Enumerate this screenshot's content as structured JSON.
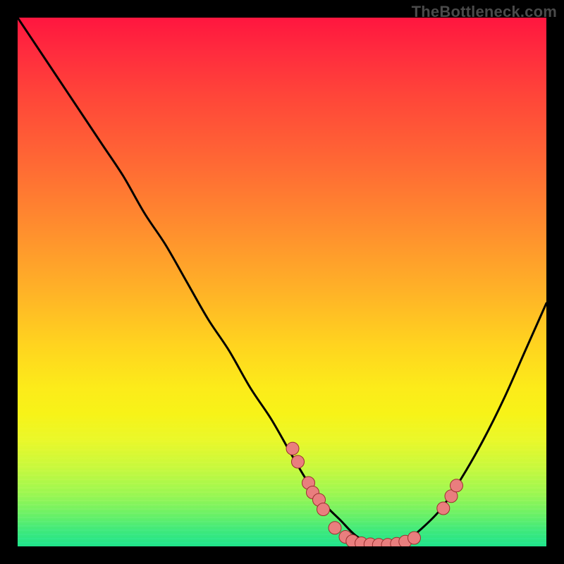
{
  "watermark": "TheBottleneck.com",
  "chart_data": {
    "type": "line",
    "title": "",
    "xlabel": "",
    "ylabel": "",
    "xlim": [
      0,
      100
    ],
    "ylim": [
      0,
      100
    ],
    "grid": false,
    "series": [
      {
        "name": "curve",
        "x": [
          0,
          4,
          8,
          12,
          16,
          20,
          24,
          28,
          32,
          36,
          40,
          44,
          48,
          52,
          55,
          58,
          61,
          64,
          67,
          70,
          73,
          76,
          80,
          84,
          88,
          92,
          96,
          100
        ],
        "y": [
          100,
          94,
          88,
          82,
          76,
          70,
          63,
          57,
          50,
          43,
          37,
          30,
          24,
          17,
          12,
          8,
          5,
          2,
          0.5,
          0,
          0.7,
          3,
          7,
          13,
          20,
          28,
          37,
          46
        ]
      }
    ],
    "markers": [
      {
        "x": 52.0,
        "y": 18.5
      },
      {
        "x": 53.0,
        "y": 16.0
      },
      {
        "x": 55.0,
        "y": 12.0
      },
      {
        "x": 55.8,
        "y": 10.2
      },
      {
        "x": 57.0,
        "y": 8.8
      },
      {
        "x": 57.8,
        "y": 7.0
      },
      {
        "x": 60.0,
        "y": 3.5
      },
      {
        "x": 62.0,
        "y": 1.8
      },
      {
        "x": 63.3,
        "y": 1.0
      },
      {
        "x": 65.0,
        "y": 0.6
      },
      {
        "x": 66.7,
        "y": 0.4
      },
      {
        "x": 68.3,
        "y": 0.3
      },
      {
        "x": 70.0,
        "y": 0.3
      },
      {
        "x": 71.7,
        "y": 0.5
      },
      {
        "x": 73.3,
        "y": 0.9
      },
      {
        "x": 75.0,
        "y": 1.6
      },
      {
        "x": 80.5,
        "y": 7.2
      },
      {
        "x": 82.0,
        "y": 9.5
      },
      {
        "x": 83.0,
        "y": 11.5
      }
    ],
    "marker_style": {
      "fill": "#e97e7e",
      "stroke": "#9a2f2f",
      "r": 9
    },
    "line_style": {
      "stroke": "#000000",
      "width": 3
    }
  }
}
